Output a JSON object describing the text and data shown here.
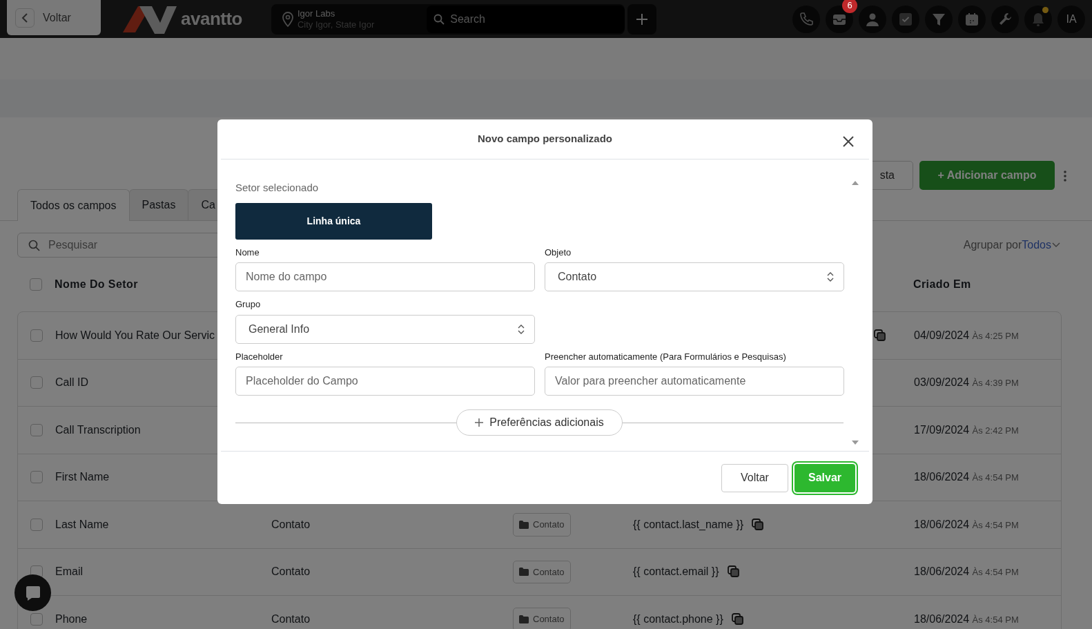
{
  "topbar": {
    "back_button": "Voltar",
    "logo_text": "avantto",
    "location": {
      "name": "Igor Labs",
      "address": "City Igor, State Igor"
    },
    "search": {
      "placeholder": "Search"
    },
    "inbox_count": "6",
    "bell_alert": true,
    "avatar": "IA"
  },
  "page": {
    "tabs": [
      {
        "label": "Todos os campos",
        "selected": true
      },
      {
        "label": "Pastas",
        "selected": false
      },
      {
        "label": "Ca",
        "selected": false
      }
    ],
    "secondary_button": "sta",
    "add_button": "+ Adicionar campo",
    "search": {
      "placeholder": "Pesquisar"
    },
    "group_by": {
      "label": "Agrupar por",
      "value": "Todos"
    },
    "table": {
      "all_checked": false,
      "columns": [
        "Nome Do Setor",
        "Criado Em"
      ],
      "rows": [
        {
          "name": "How Would You Rate Our Servic",
          "checked": false,
          "copyable": true,
          "date": "04/09/2024",
          "time": "Às 4:25 PM"
        },
        {
          "name": "Call ID",
          "checked": false,
          "copyable": false,
          "date": "03/09/2024",
          "time": "Às 4:39 PM"
        },
        {
          "name": "Call Transcription",
          "checked": false,
          "copyable": false,
          "date": "17/09/2024",
          "time": "Às 2:42 PM"
        },
        {
          "name": "First Name",
          "checked": false,
          "copyable": false,
          "date": "18/06/2024",
          "time": "Às 4:54 PM"
        },
        {
          "name": "Last Name",
          "checked": false,
          "copyable": true,
          "object": "Contato",
          "folder": "Contato",
          "key": "{{ contact.last_name }}",
          "date": "18/06/2024",
          "time": "Às 4:54 PM"
        },
        {
          "name": "Email",
          "checked": false,
          "copyable": true,
          "object": "Contato",
          "folder": "Contato",
          "key": "{{ contact.email }}",
          "date": "18/06/2024",
          "time": "Às 4:54 PM"
        },
        {
          "name": "Phone",
          "checked": false,
          "copyable": true,
          "object": "Contato",
          "folder": "Contato",
          "key": "{{ contact.phone }}",
          "date": "18/06/2024",
          "time": "Às 4:54 PM"
        }
      ]
    }
  },
  "modal": {
    "title": "Novo campo personalizado",
    "sector_label": "Setor selecionado",
    "sector_button": "Linha única",
    "field_rows": [
      [
        {
          "kind": "input",
          "label": "Nome",
          "placeholder": "Nome do campo"
        },
        {
          "kind": "select",
          "label": "Objeto",
          "value": "Contato"
        }
      ],
      [
        {
          "kind": "select",
          "label": "Grupo",
          "value": "General Info"
        }
      ],
      [
        {
          "kind": "input",
          "label": "Placeholder",
          "placeholder": "Placeholder do Campo"
        },
        {
          "kind": "input",
          "label": "Preencher automaticamente (Para Formulários e Pesquisas)",
          "placeholder": "Valor para preencher automaticamente"
        }
      ]
    ],
    "more_button": "Preferências adicionais",
    "buttons": [
      {
        "label": "Voltar",
        "kind": "secondary",
        "focused": false
      },
      {
        "label": "Salvar",
        "kind": "primary",
        "focused": true
      }
    ]
  }
}
